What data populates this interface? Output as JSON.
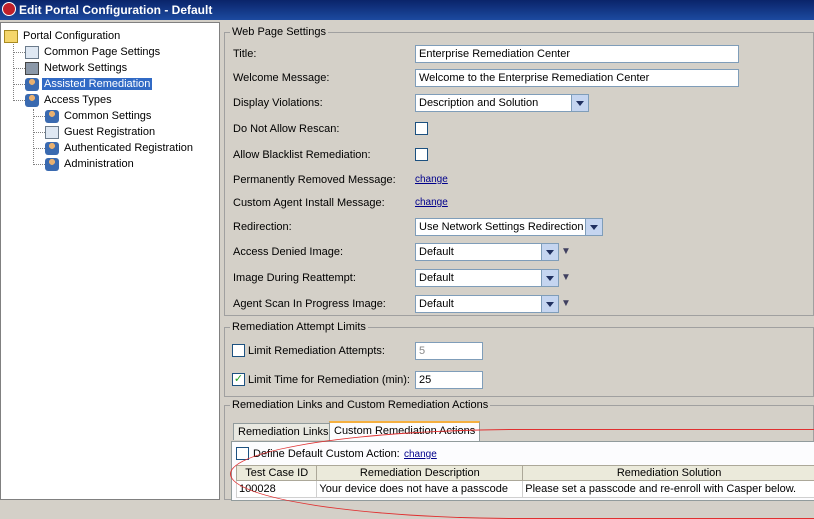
{
  "window": {
    "title": "Edit Portal Configuration - Default"
  },
  "tree": {
    "root": "Portal Configuration",
    "items": [
      {
        "label": "Common Page Settings"
      },
      {
        "label": "Network Settings"
      },
      {
        "label": "Assisted Remediation",
        "selected": true
      }
    ],
    "access_types": {
      "label": "Access Types",
      "children": [
        {
          "label": "Common Settings"
        },
        {
          "label": "Guest Registration"
        },
        {
          "label": "Authenticated Registration"
        },
        {
          "label": "Administration"
        }
      ]
    }
  },
  "web_page_settings": {
    "legend": "Web Page Settings",
    "title_label": "Title:",
    "title_value": "Enterprise Remediation Center",
    "welcome_label": "Welcome Message:",
    "welcome_value": "Welcome to the Enterprise Remediation Center",
    "display_violations_label": "Display Violations:",
    "display_violations_value": "Description and Solution",
    "no_rescan_label": "Do Not Allow Rescan:",
    "no_rescan_checked": false,
    "blacklist_label": "Allow Blacklist Remediation:",
    "blacklist_checked": false,
    "perm_removed_label": "Permanently Removed Message:",
    "perm_removed_link": "change",
    "custom_agent_label": "Custom Agent Install Message:",
    "custom_agent_link": "change",
    "redirection_label": "Redirection:",
    "redirection_value": "Use Network Settings Redirection",
    "access_denied_label": "Access Denied Image:",
    "access_denied_value": "Default",
    "reattempt_label": "Image During Reattempt:",
    "reattempt_value": "Default",
    "scan_progress_label": "Agent Scan In Progress Image:",
    "scan_progress_value": "Default"
  },
  "attempt_limits": {
    "legend": "Remediation Attempt Limits",
    "limit_attempts_label": "Limit Remediation Attempts:",
    "limit_attempts_checked": false,
    "limit_attempts_value": "5",
    "limit_time_label": "Limit Time for Remediation (min):",
    "limit_time_checked": true,
    "limit_time_value": "25"
  },
  "links_actions": {
    "legend": "Remediation Links and Custom Remediation Actions",
    "tabs": [
      "Remediation Links",
      "Custom Remediation Actions"
    ],
    "active_tab": 1,
    "define_default_label": "Define Default Custom Action:",
    "define_default_checked": false,
    "define_default_link": "change",
    "columns": [
      "Test Case ID",
      "Remediation Description",
      "Remediation Solution"
    ],
    "rows": [
      [
        "100028",
        "Your device does not have a passcode",
        "Please set a passcode and re-enroll with Casper below."
      ]
    ]
  },
  "colors": {
    "selection": "#316ac5",
    "highlight_ellipse": "#e03030",
    "titlebar": "#0a246a"
  }
}
